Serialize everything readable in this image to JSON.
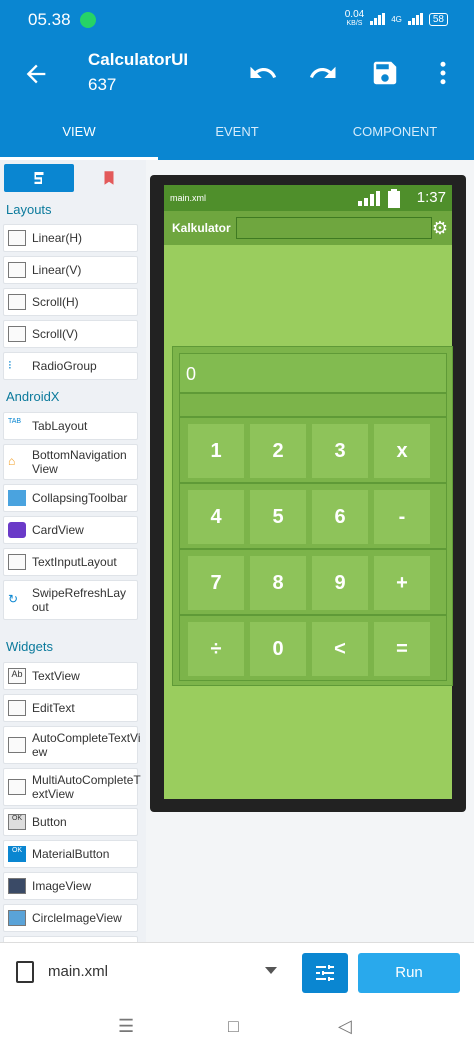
{
  "status_bar": {
    "time": "05.38",
    "net_speed": "0.04",
    "net_unit": "KB/S",
    "network_type": "4G",
    "battery": "58"
  },
  "app_bar": {
    "title": "CalculatorUI",
    "subtitle": "637"
  },
  "tabs": [
    {
      "label": "VIEW",
      "active": true
    },
    {
      "label": "EVENT"
    },
    {
      "label": "COMPONENT"
    }
  ],
  "palette": {
    "layouts_title": "Layouts",
    "layouts": [
      "Linear(H)",
      "Linear(V)",
      "Scroll(H)",
      "Scroll(V)",
      "RadioGroup"
    ],
    "androidx_title": "AndroidX",
    "androidx": [
      "TabLayout",
      "BottomNavigation View",
      "CollapsingToolbar",
      "CardView",
      "TextInputLayout",
      "SwipeRefreshLay out"
    ],
    "widgets_title": "Widgets",
    "widgets": [
      "TextView",
      "EditText",
      "AutoCompleteTextVi ew",
      "MultiAutoCompleteT extView",
      "Button",
      "MaterialButton",
      "ImageView",
      "CircleImageView"
    ]
  },
  "device": {
    "file_name": "main.xml",
    "time": "1:37",
    "toolbar_title": "Kalkulator",
    "display_value": "0",
    "keys": [
      [
        "1",
        "2",
        "3",
        "x"
      ],
      [
        "4",
        "5",
        "6",
        "-"
      ],
      [
        "7",
        "8",
        "9",
        "+"
      ],
      [
        "÷",
        "0",
        "<",
        "="
      ]
    ]
  },
  "bottom_bar": {
    "file": "main.xml",
    "run_label": "Run"
  }
}
